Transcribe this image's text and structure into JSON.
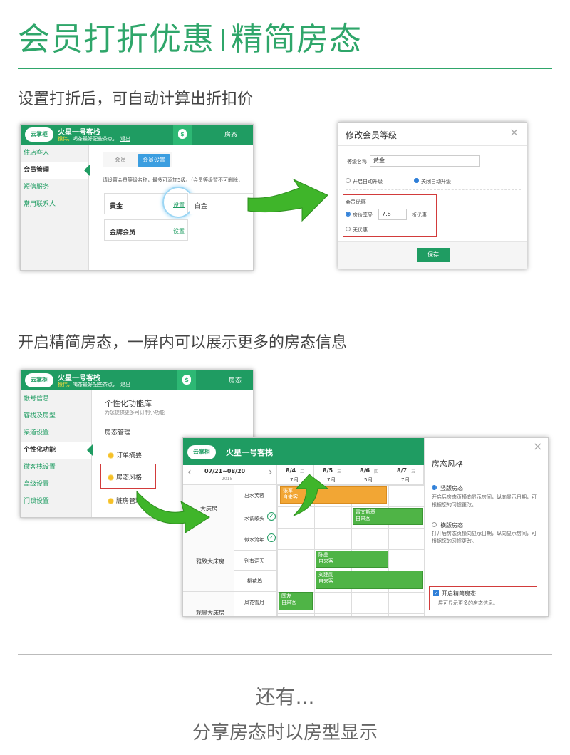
{
  "header": {
    "title_left": "会员打折优惠",
    "title_right": "精简房态"
  },
  "section1": {
    "heading": "设置打折后，可自动计算出折扣价"
  },
  "section2": {
    "heading": "开启精简房态，一屏内可以展示更多的房态信息"
  },
  "app": {
    "logo": "云掌柜",
    "hotel_name": "火星一号客栈",
    "subtitle_user": "猴伟，",
    "subtitle_text": "喝茶最好配些茶点，",
    "logout": "退出",
    "money_icon": "$",
    "room_tab": "房态"
  },
  "shot1": {
    "sidebar": [
      "住店客人",
      "会员管理",
      "短信服务",
      "常用联系人"
    ],
    "tabs": [
      "会员",
      "会员设置"
    ],
    "desc": "请设置会员等级名称，最多可添加5级。（会员等级暂不可删除，",
    "cards": [
      {
        "name": "黄金",
        "link": "设置"
      },
      {
        "name": "白金"
      },
      {
        "name": "金牌会员",
        "link": "设置"
      }
    ]
  },
  "modal": {
    "title": "修改会员等级",
    "close": "×",
    "level_label": "等级名称",
    "level_value": "黄金",
    "radio_on_upgrade": "开启自动升级",
    "radio_off_upgrade": "关闭自动升级",
    "discount_title": "会员优惠",
    "discount_label": "房价享受",
    "discount_value": "7.8",
    "discount_unit": "折优惠",
    "no_discount": "无优惠",
    "save": "保存"
  },
  "shot2": {
    "sidebar": [
      "帐号信息",
      "客栈及房型",
      "渠道设置",
      "个性化功能",
      "微客栈设置",
      "高级设置",
      "门锁设置"
    ],
    "title": "个性化功能库",
    "subtitle": "为您提供更多可订制小功能",
    "section": "房态管理",
    "items": [
      "订单摘要",
      "房态风格",
      "脏房管理"
    ]
  },
  "roomview": {
    "hotel_name": "火星一号客栈",
    "range": "07/21~08/20",
    "year": "2015",
    "dates": [
      {
        "d": "8/4",
        "w": "二",
        "n": "7间"
      },
      {
        "d": "8/5",
        "w": "三",
        "n": "7间"
      },
      {
        "d": "8/6",
        "w": "四",
        "n": "5间"
      },
      {
        "d": "8/7",
        "w": "五",
        "n": "7间"
      }
    ],
    "types": [
      "大床房",
      "雅致大床房",
      "观景大床房"
    ],
    "rooms": [
      "出水芙蓉",
      "水调歌头",
      "似水流年",
      "别有洞天",
      "桃花坞",
      "风花雪月"
    ],
    "bookings": [
      {
        "name": "张军",
        "src": "自来客"
      },
      {
        "name": "雷文斯基",
        "src": "自来客"
      },
      {
        "name": "陈晶",
        "src": "自来客"
      },
      {
        "name": "刘建勋",
        "src": "自来客"
      },
      {
        "name": "国友",
        "src": "自来客"
      }
    ],
    "style_title": "房态风格",
    "opt1_title": "竖版房态",
    "opt1_desc": "开启后房态页横向显示房间，纵向显示日期，可根据您的习惯更改。",
    "opt2_title": "横版房态",
    "opt2_desc": "打开后房态页横向显示日期，纵向显示房间，可根据您的习惯更改。",
    "simple_title": "开启精简房态",
    "simple_desc": "一屏可显示更多的房态信息。",
    "close": "×"
  },
  "footer": {
    "line1": "还有...",
    "line2": "分享房态时以房型显示"
  },
  "colors": {
    "brand": "#1f9c62",
    "title_green": "#2fa66a",
    "arrow": "#3fb52a",
    "highlight": "#d23b3b"
  }
}
